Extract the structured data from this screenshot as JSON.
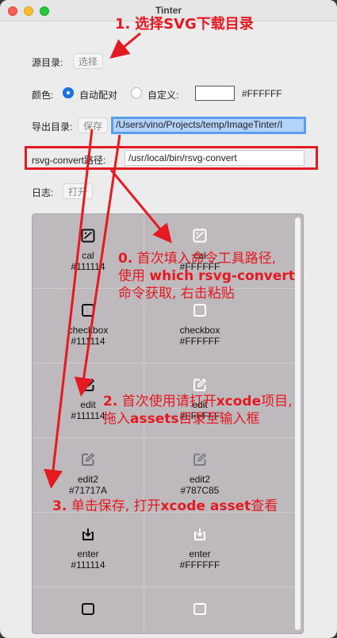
{
  "window": {
    "title": "Tinter"
  },
  "source": {
    "label": "源目录:",
    "button": "选择"
  },
  "color": {
    "label": "颜色:",
    "auto_label": "自动配对",
    "custom_label": "自定义:",
    "hex": "#FFFFFF",
    "swatch": "#FFFFFF"
  },
  "export": {
    "label": "导出目录:",
    "button": "保存",
    "path": "/Users/vino/Projects/temp/ImageTinter/I"
  },
  "rsvg": {
    "label": "rsvg-convert路径:",
    "path": "/usr/local/bin/rsvg-convert"
  },
  "log": {
    "label": "日志:",
    "button": "打开"
  },
  "assets": [
    {
      "left_name": "cal",
      "left_color": "#111114",
      "right_name": "cal",
      "right_color": "#FFFFFF"
    },
    {
      "left_name": "checkbox",
      "left_color": "#111114",
      "right_name": "checkbox",
      "right_color": "#FFFFFF"
    },
    {
      "left_name": "edit",
      "left_color": "#111114",
      "right_name": "edit",
      "right_color": "#FFFFFF"
    },
    {
      "left_name": "edit2",
      "left_color": "#71717A",
      "right_name": "edit2",
      "right_color": "#787C85"
    },
    {
      "left_name": "enter",
      "left_color": "#111114",
      "right_name": "enter",
      "right_color": "#FFFFFF"
    }
  ],
  "annotations": {
    "a1_num": "1.",
    "a1_text": "选择SVG下载目录",
    "a0_num": "0.",
    "a0_l1": "首次填入命令工具路径,",
    "a0_l2a": "使用 ",
    "a0_l2b": "which rsvg-convert",
    "a0_l3": "命令获取, 右击粘贴",
    "a2_num": "2.",
    "a2_l1a": "首次使用请打开",
    "a2_l1b": "xcode",
    "a2_l1c": "项目,",
    "a2_l2a": "拖入",
    "a2_l2b": "assets",
    "a2_l2c": "目录至输入框",
    "a3_num": "3.",
    "a3_a": "单击保存, 打开",
    "a3_b": "xcode asset",
    "a3_c": "查看"
  }
}
